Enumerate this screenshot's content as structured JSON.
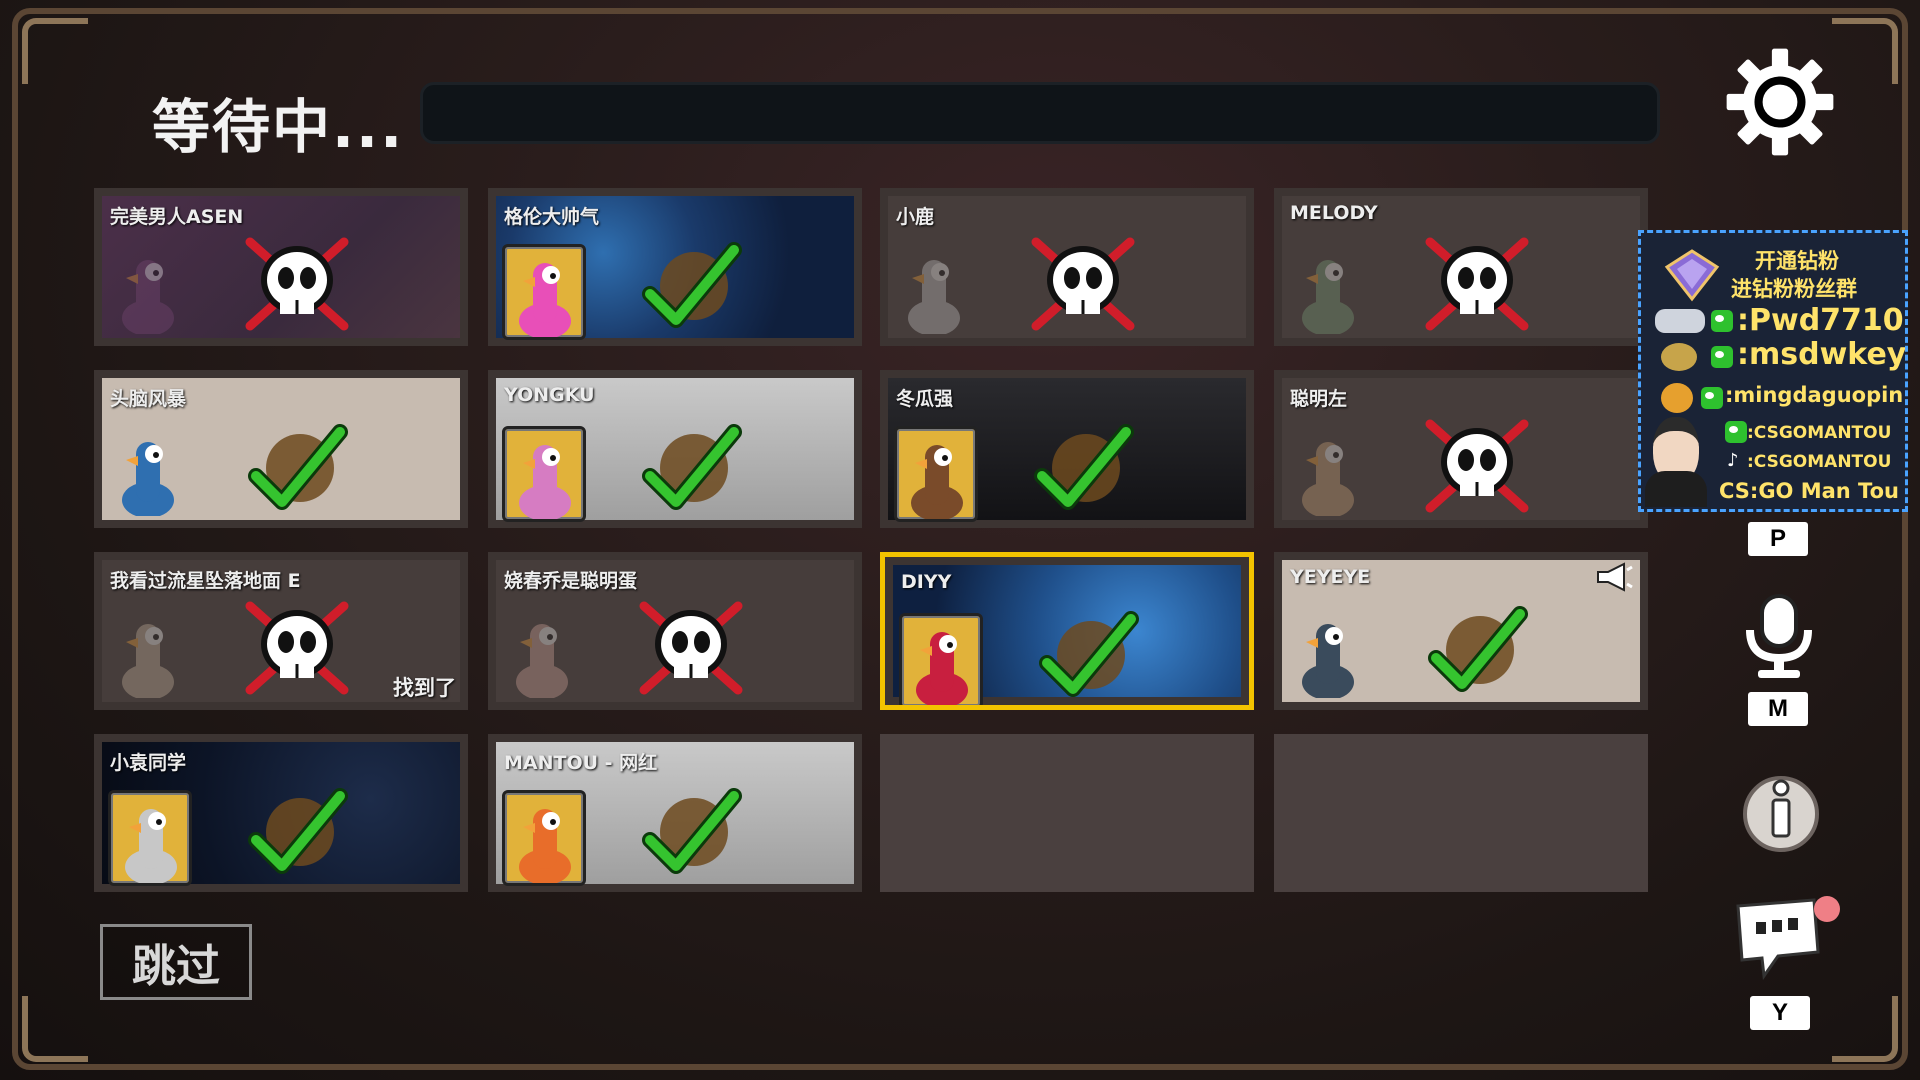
{
  "header": {
    "status_title": "等待中...",
    "progress": 0.0
  },
  "players": [
    {
      "name": "完美男人ASEN",
      "state": "dead",
      "bg": "pinkgrid"
    },
    {
      "name": "格伦大帅气",
      "state": "alive",
      "bg": "blue"
    },
    {
      "name": "小鹿",
      "state": "dead",
      "bg": ""
    },
    {
      "name": "MELODY",
      "state": "dead",
      "bg": ""
    },
    {
      "name": "头脑风暴",
      "state": "alive",
      "bg": ""
    },
    {
      "name": "YONGKU",
      "state": "alive",
      "bg": "gray"
    },
    {
      "name": "冬瓜强",
      "state": "alive",
      "bg": "dark"
    },
    {
      "name": "聪明左",
      "state": "dead",
      "bg": ""
    },
    {
      "name": "我看过流星坠落地面 E",
      "state": "dead",
      "bg": "",
      "found_label": "找到了"
    },
    {
      "name": "娆春乔是聪明蛋",
      "state": "dead",
      "bg": ""
    },
    {
      "name": "DIYY",
      "state": "alive",
      "bg": "blue2",
      "selected": true
    },
    {
      "name": "YEYEYE",
      "state": "alive",
      "bg": "",
      "speaking": true
    },
    {
      "name": "小袁同学",
      "state": "alive",
      "bg": "space"
    },
    {
      "name": "MANTOU - 网红",
      "state": "alive",
      "bg": "gray"
    }
  ],
  "skip_button": {
    "label": "跳过"
  },
  "sidebar": {
    "settings_icon": "gear-icon",
    "keys": {
      "p": "P",
      "m": "M",
      "y": "Y"
    },
    "icons": [
      "microphone-icon",
      "info-icon",
      "chat-icon"
    ]
  },
  "promo": {
    "line1": "开通钻粉",
    "line2": "进钻粉粉丝群",
    "line3": ":Pwd7710",
    "line4": ":msdwkey",
    "line5": ":mingdaguopin",
    "line6": ":CSGOMANTOU",
    "line7": ":CSGOMANTOU",
    "line8": "CS:GO Man Tou"
  },
  "colors": {
    "selected": "#f3c300",
    "check": "#35c42f",
    "cross": "#d11d2a",
    "frame": "#5b4634"
  }
}
